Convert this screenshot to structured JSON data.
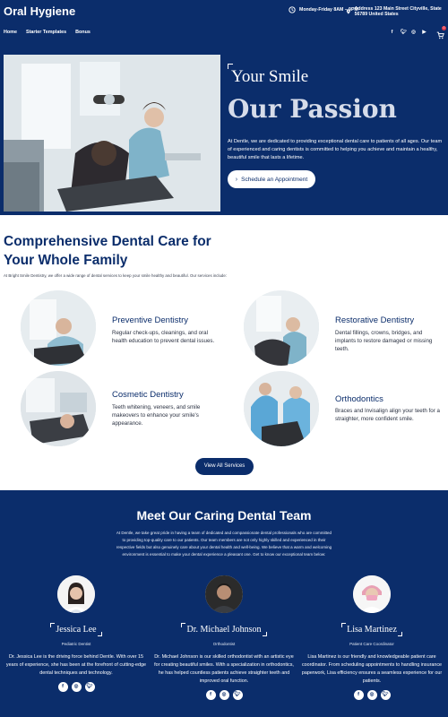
{
  "header": {
    "logo": "Oral Hygiene",
    "hours": "Monday-Friday 8AM – 9PM",
    "address": "Address 123 Main Street Cityville, State 56789 United States",
    "nav": [
      "Home",
      "Starter Templates",
      "Bonus"
    ],
    "social": [
      "f",
      "t",
      "ig",
      "yt"
    ],
    "cart_count": "0"
  },
  "hero": {
    "subtitle": "Your Smile",
    "title": "Our Passion",
    "text": "At Dentle, we are dedicated to providing exceptional dental care to patients of all ages. Our team of experienced and caring dentists is committed to helping you achieve and maintain a healthy, beautiful smile that lasts a lifetime.",
    "button": "Schedule an Appointment"
  },
  "services": {
    "title": "Comprehensive Dental Care for Your Whole Family",
    "intro": "At Bright Smile Dentistry, we offer a wide range of dental services to keep your smile healthy and beautiful. Our services include:",
    "items": [
      {
        "title": "Preventive Dentistry",
        "text": "Regular check-ups, cleanings, and oral health education to prevent dental issues."
      },
      {
        "title": "Restorative Dentistry",
        "text": "Dental fillings, crowns, bridges, and implants to restore damaged or missing teeth."
      },
      {
        "title": "Cosmetic Dentistry",
        "text": "Teeth whitening, veneers, and smile makeovers to enhance your smile's appearance."
      },
      {
        "title": "Orthodontics",
        "text": "Braces and Invisalign align your teeth for a straighter, more confident smile."
      }
    ],
    "button": "View All Services"
  },
  "team": {
    "title": "Meet Our Caring Dental Team",
    "text": "At Dentle, we take great pride in having a team of dedicated and compassionate dental professionals who are committed to providing top-quality care to our patients. Our team members are not only highly skilled and experienced in their respective fields but also genuinely care about your dental health and well-being. We believe that a warm and welcoming environment is essential to make your dental experience a pleasant one. Get to know our exceptional team below:",
    "members": [
      {
        "name": "Jessica Lee",
        "role": "Pediatric Dentist",
        "bio": "Dr. Jessica Lee is the driving force behind Dentle. With over 15 years of experience, she has been at the forefront of cutting-edge dental techniques and technology."
      },
      {
        "name": "Dr. Michael Johnson",
        "role": "Orthodontist",
        "bio": "Dr. Michael Johnson is our skilled orthodontist with an artistic eye for creating beautiful smiles. With a specialization in orthodontics, he has helped countless patients achieve straighter teeth and improved oral function."
      },
      {
        "name": "Lisa Martinez",
        "role": "Patient Care Coordinator",
        "bio": "Lisa Martinez is our friendly and knowledgeable patient care coordinator. From scheduling appointments to handling insurance paperwork, Lisa efficiency ensures a seamless experience for our patients."
      }
    ],
    "social": [
      "f",
      "in",
      "t"
    ]
  }
}
